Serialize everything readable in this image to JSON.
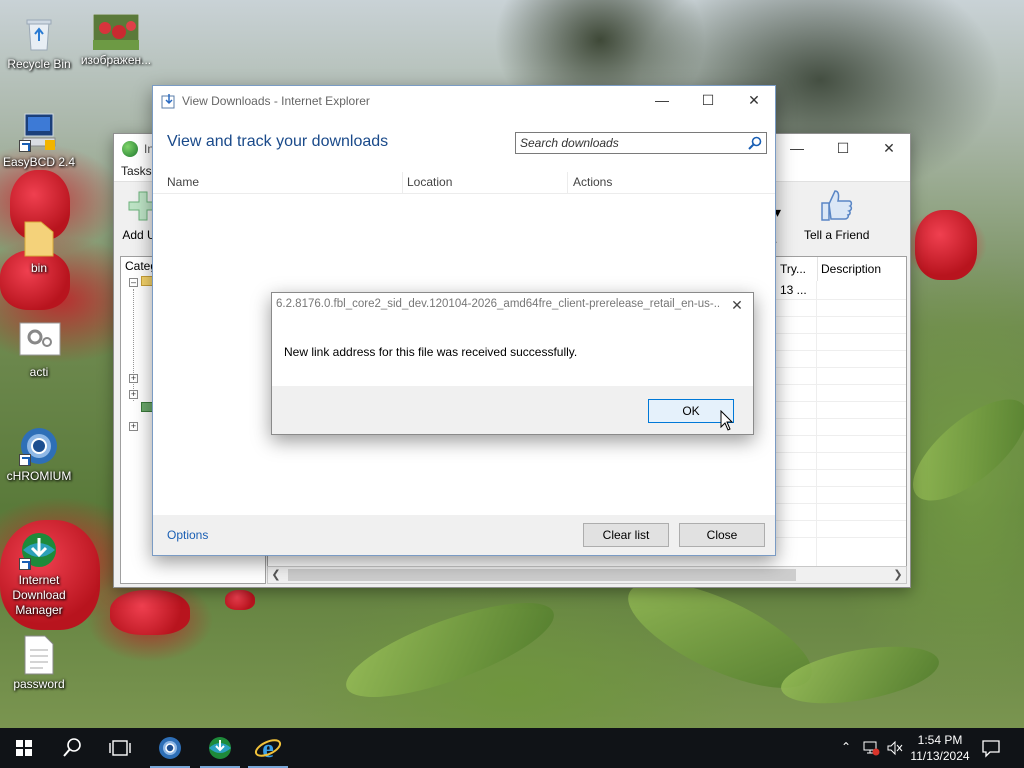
{
  "desktop": {
    "icons": [
      {
        "label": "Recycle Bin",
        "icon": "recycle-bin-icon"
      },
      {
        "label": "изображен...",
        "icon": "image-file-icon"
      },
      {
        "label": "EasyBCD 2.4",
        "icon": "easybcd-icon"
      },
      {
        "label": "bin",
        "icon": "folder-icon"
      },
      {
        "label": "acti",
        "icon": "settings-file-icon"
      },
      {
        "label": "cHROMIUM",
        "icon": "chromium-icon"
      },
      {
        "label": "Internet Download Manager",
        "icon": "idm-icon"
      },
      {
        "label": "password",
        "icon": "text-file-icon"
      }
    ]
  },
  "idm_window": {
    "title": "In",
    "menu_tasks": "Tasks",
    "toolbar": {
      "add_url": "Add U",
      "tell_friend": "Tell a Friend",
      "partial_dot": "."
    },
    "categories_header": "Categ",
    "list_columns": {
      "tries": "Try...",
      "description": "Description"
    },
    "first_row": {
      "tries": "13 ..."
    }
  },
  "view_downloads": {
    "title": "View Downloads - Internet Explorer",
    "heading": "View and track your downloads",
    "search_placeholder": "Search downloads",
    "columns": {
      "name": "Name",
      "location": "Location",
      "actions": "Actions"
    },
    "options_link": "Options",
    "clear_list_button": "Clear list",
    "close_button": "Close"
  },
  "message_dialog": {
    "title": "6.2.8176.0.fbl_core2_sid_dev.120104-2026_amd64fre_client-prerelease_retail_en-us-...",
    "message": "New link address for this file was received successfully.",
    "ok_button": "OK"
  },
  "taskbar": {
    "time": "1:54 PM",
    "date": "11/13/2024",
    "pinned": [
      "start-icon",
      "search-icon",
      "task-view-icon",
      "chromium-icon",
      "idm-icon",
      "internet-explorer-icon"
    ]
  },
  "colors": {
    "accent_blue": "#0078d7",
    "heading_blue": "#1a4a8a",
    "taskbar": "#101317"
  }
}
